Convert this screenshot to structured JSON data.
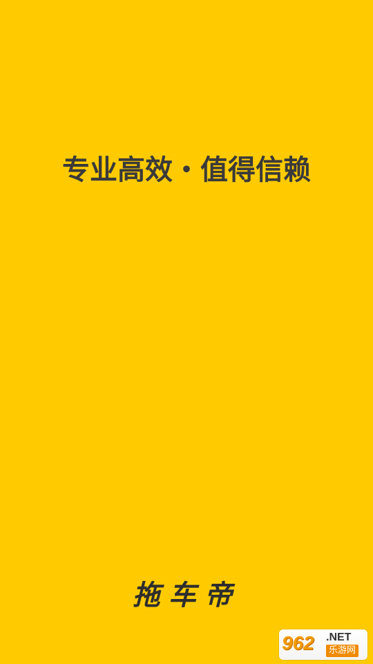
{
  "splash": {
    "slogan": "专业高效・值得信赖",
    "brand_name": "拖车帝",
    "background_color": "#FFCB00",
    "text_color": "#3A3A3A"
  },
  "watermark": {
    "number": "962",
    "domain": ".NET",
    "site_name": "乐游网"
  }
}
